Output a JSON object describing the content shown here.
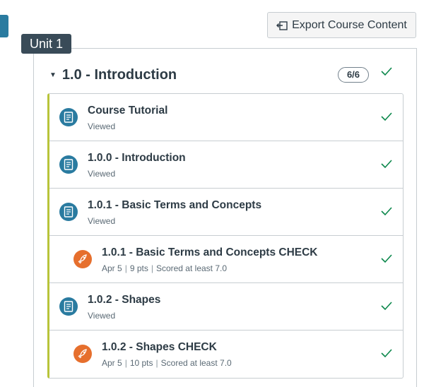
{
  "toolbar": {
    "export_label": "Export Course Content"
  },
  "unit_label": "Unit 1",
  "module": {
    "title": "1.0 - Introduction",
    "progress": "6/6",
    "items": [
      {
        "type": "page",
        "title": "Course Tutorial",
        "status": "Viewed"
      },
      {
        "type": "page",
        "title": "1.0.0 - Introduction",
        "status": "Viewed"
      },
      {
        "type": "page",
        "title": "1.0.1 - Basic Terms and Concepts",
        "status": "Viewed"
      },
      {
        "type": "quiz",
        "title": "1.0.1 - Basic Terms and Concepts CHECK",
        "date": "Apr 5",
        "points": "9 pts",
        "requirement": "Scored at least 7.0"
      },
      {
        "type": "page",
        "title": "1.0.2 - Shapes",
        "status": "Viewed"
      },
      {
        "type": "quiz",
        "title": "1.0.2 - Shapes CHECK",
        "date": "Apr 5",
        "points": "10 pts",
        "requirement": "Scored at least 7.0"
      }
    ]
  },
  "colors": {
    "accent_blue": "#2a7ba0",
    "quiz_orange": "#e66f2d",
    "check_green": "#0b874b",
    "module_bar": "#b8c43a"
  }
}
